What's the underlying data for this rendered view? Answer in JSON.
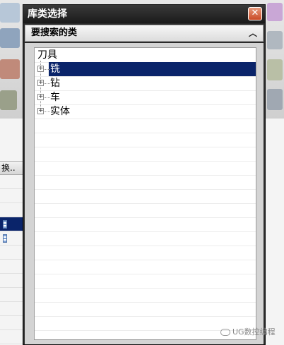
{
  "dialog": {
    "title": "库类选择",
    "close_glyph": "✕"
  },
  "section": {
    "header": "要搜索的类",
    "collapse_glyph": "︿"
  },
  "tree": {
    "root": "刀具",
    "children": [
      {
        "label": "铣",
        "selected": true
      },
      {
        "label": "钻",
        "selected": false
      },
      {
        "label": "车",
        "selected": false
      },
      {
        "label": "实体",
        "selected": false
      }
    ],
    "expander_glyph": "+"
  },
  "background": {
    "column_header": "换.."
  },
  "watermark": {
    "text": "UG数控编程"
  },
  "colors": {
    "selection": "#0a246a",
    "close_button": "#c94a26",
    "titlebar": "#1a1a1a"
  }
}
